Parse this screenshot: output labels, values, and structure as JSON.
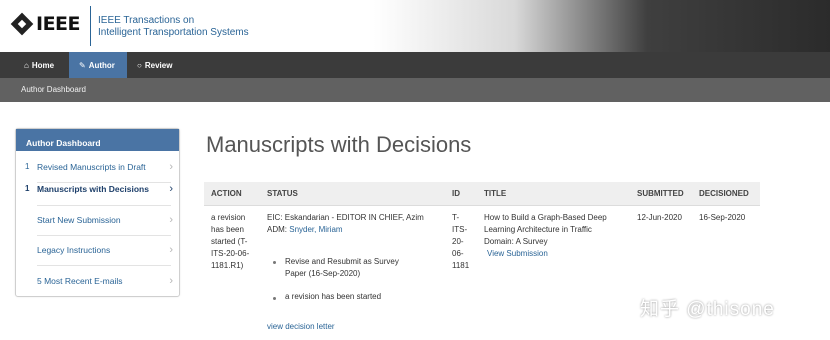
{
  "header": {
    "logo_text": "IEEE",
    "journal_line1": "IEEE Transactions on",
    "journal_line2": "Intelligent Transportation Systems"
  },
  "nav": {
    "items": [
      {
        "label": "Home",
        "icon": "home-icon"
      },
      {
        "label": "Author",
        "icon": "pencil-icon",
        "active": true
      },
      {
        "label": "Review",
        "icon": "speech-bubble-icon"
      }
    ]
  },
  "breadcrumb": "Author Dashboard",
  "sidebar": {
    "title": "Author Dashboard",
    "items": [
      {
        "num": "1",
        "label": "Revised Manuscripts in Draft"
      },
      {
        "num": "1",
        "label": "Manuscripts with Decisions",
        "active": true
      },
      {
        "num": "",
        "label": "Start New Submission"
      },
      {
        "num": "",
        "label": "Legacy Instructions"
      },
      {
        "num": "",
        "label": "5 Most Recent E-mails"
      }
    ]
  },
  "main": {
    "title": "Manuscripts with Decisions",
    "columns": [
      "ACTION",
      "STATUS",
      "ID",
      "TITLE",
      "SUBMITTED",
      "DECISIONED"
    ],
    "row": {
      "action": [
        "a revision",
        "has been",
        "started (T-",
        "ITS-20-06-",
        "1181.R1)"
      ],
      "status_line1": "EIC: Eskandarian - EDITOR IN CHIEF, Azim",
      "status_adm_label": "ADM:",
      "status_adm_name": "Snyder, Miriam",
      "status_bullet1": [
        "Revise and Resubmit as Survey",
        "Paper (16-Sep-2020)"
      ],
      "status_bullet2": "a revision has been started",
      "decision_link": "view decision letter",
      "id": [
        "T-",
        "ITS-",
        "20-",
        "06-",
        "1181"
      ],
      "title": [
        "How to Build a Graph-Based Deep",
        "Learning Architecture in Traffic",
        "Domain: A Survey"
      ],
      "view_submission": "View Submission",
      "submitted": "12-Jun-2020",
      "decisioned": "16-Sep-2020"
    }
  },
  "watermark": "知乎 @thisone",
  "colors": {
    "accent": "#4a74a4",
    "link": "#2a6496",
    "nav_bg": "#3b3b3b",
    "subbar_bg": "#616161"
  }
}
